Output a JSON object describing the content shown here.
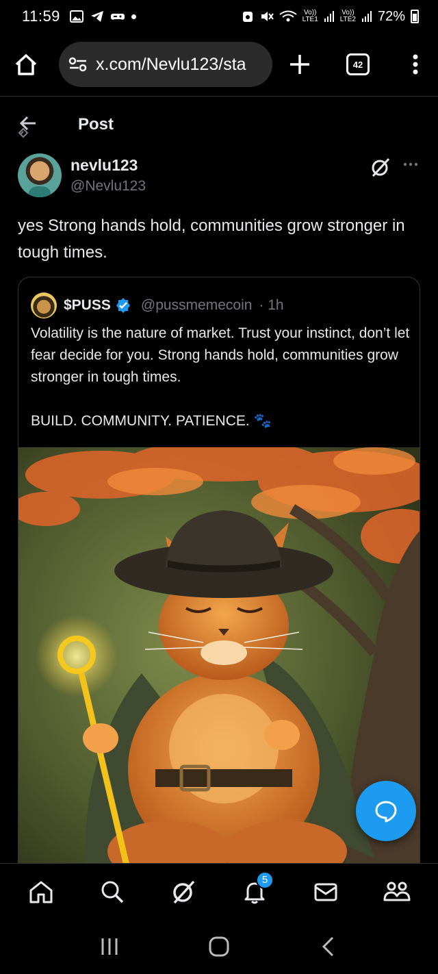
{
  "status_bar": {
    "time": "11:59",
    "battery_percent": "72%",
    "network_1": "Vo))\nLTE1",
    "network_2": "Vo))\nLTE2"
  },
  "browser": {
    "url": "x.com/Nevlu123/sta",
    "tab_count": "42"
  },
  "header": {
    "title": "Post"
  },
  "post": {
    "author_name": "nevlu123",
    "author_handle": "@Nevlu123",
    "text": "yes Strong hands hold, communities grow stronger in tough times."
  },
  "quote": {
    "name": "$PUSS",
    "handle": "@pussmemecoin",
    "time": "· 1h",
    "text": "Volatility is the nature of market. Trust your instinct, don’t let fear decide for you. Strong hands hold, communities grow stronger in tough times.\n\nBUILD. COMMUNITY. PATIENCE. 🐾"
  },
  "tabbar": {
    "notifications_badge": "5"
  },
  "colors": {
    "accent": "#1d9bf0",
    "secondary_text": "#71767b",
    "background": "#000000"
  }
}
